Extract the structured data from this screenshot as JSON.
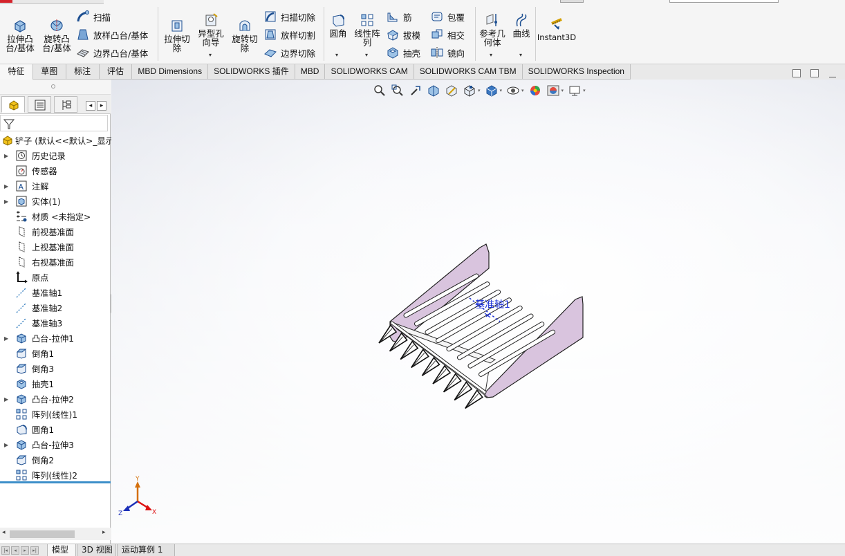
{
  "ribbon": {
    "extrude_boss": "拉伸凸\n台/基体",
    "revolve_boss": "旋转凸\n台/基体",
    "sweep": "扫描",
    "loft_boss": "放样凸台/基体",
    "boundary_boss": "边界凸台/基体",
    "extrude_cut": "拉伸切\n除",
    "hole_wizard": "异型孔\n向导",
    "revolve_cut": "旋转切\n除",
    "swept_cut": "扫描切除",
    "lofted_cut": "放样切割",
    "boundary_cut": "边界切除",
    "fillet": "圆角",
    "linear_pattern": "线性阵\n列",
    "rib": "筋",
    "draft": "拔模",
    "shell": "抽壳",
    "wrap": "包覆",
    "intersect": "相交",
    "mirror": "镜向",
    "ref_geometry": "参考几\n何体",
    "curves": "曲线",
    "instant3d": "Instant3D"
  },
  "tabs": [
    "特征",
    "草图",
    "标注",
    "评估",
    "MBD Dimensions",
    "SOLIDWORKS 插件",
    "MBD",
    "SOLIDWORKS CAM",
    "SOLIDWORKS CAM TBM",
    "SOLIDWORKS Inspection"
  ],
  "tree": {
    "root": "铲子 (默认<<默认>_显示",
    "items": [
      {
        "label": "历史记录",
        "expand": true
      },
      {
        "label": "传感器",
        "expand": false
      },
      {
        "label": "注解",
        "expand": true
      },
      {
        "label": "实体(1)",
        "expand": true
      },
      {
        "label": "材质 <未指定>",
        "expand": false
      },
      {
        "label": "前视基准面",
        "expand": false
      },
      {
        "label": "上视基准面",
        "expand": false
      },
      {
        "label": "右视基准面",
        "expand": false
      },
      {
        "label": "原点",
        "expand": false
      },
      {
        "label": "基准轴1",
        "expand": false
      },
      {
        "label": "基准轴2",
        "expand": false
      },
      {
        "label": "基准轴3",
        "expand": false
      },
      {
        "label": "凸台-拉伸1",
        "expand": true
      },
      {
        "label": "倒角1",
        "expand": false
      },
      {
        "label": "倒角3",
        "expand": false
      },
      {
        "label": "抽壳1",
        "expand": false
      },
      {
        "label": "凸台-拉伸2",
        "expand": true
      },
      {
        "label": "阵列(线性)1",
        "expand": false
      },
      {
        "label": "圆角1",
        "expand": false
      },
      {
        "label": "凸台-拉伸3",
        "expand": true
      },
      {
        "label": "倒角2",
        "expand": false
      },
      {
        "label": "阵列(线性)2",
        "expand": false
      }
    ]
  },
  "viewport": {
    "axis_label": "基准轴1",
    "triad": {
      "x": "X",
      "y": "Y",
      "z": "Z"
    }
  },
  "bottom_tabs": [
    "模型",
    "3D 视图",
    "运动算例 1"
  ],
  "colors": {
    "side_plate": "#d9c4de",
    "annotation": "#1a2fd6",
    "active_line": "#3d8fc9"
  }
}
